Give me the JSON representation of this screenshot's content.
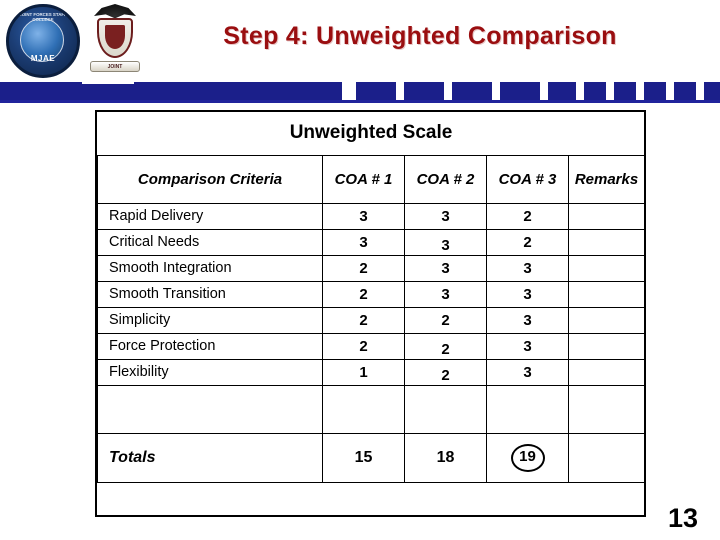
{
  "slide": {
    "title": "Step 4: Unweighted Comparison",
    "page_number": "13",
    "title_color": "#9a0e10",
    "banner_color": "#1b1f8a"
  },
  "logos": {
    "left_seal_name": "mjae-seal",
    "left_seal_arc_text": "JOINT FORCES STAFF COLLEGE",
    "left_seal_label": "MJAE",
    "right_crest_name": "jfsc-crest",
    "right_crest_motto": "JOINT"
  },
  "table": {
    "scale_header": "Unweighted Scale",
    "columns": [
      "Comparison Criteria",
      "COA # 1",
      "COA # 2",
      "COA # 3",
      "Remarks"
    ],
    "rows": [
      {
        "criteria": "Rapid Delivery",
        "coa1": "3",
        "coa2": "3",
        "coa3": "2",
        "remarks": ""
      },
      {
        "criteria": "Critical Needs",
        "coa1": "3",
        "coa2": "3",
        "coa3": "2",
        "remarks": ""
      },
      {
        "criteria": "Smooth Integration",
        "coa1": "2",
        "coa2": "3",
        "coa3": "3",
        "remarks": ""
      },
      {
        "criteria": "Smooth Transition",
        "coa1": "2",
        "coa2": "3",
        "coa3": "3",
        "remarks": ""
      },
      {
        "criteria": "Simplicity",
        "coa1": "2",
        "coa2": "2",
        "coa3": "3",
        "remarks": ""
      },
      {
        "criteria": "Force Protection",
        "coa1": "2",
        "coa2": "2",
        "coa3": "3",
        "remarks": ""
      },
      {
        "criteria": "Flexibility",
        "coa1": "1",
        "coa2": "2",
        "coa3": "3",
        "remarks": ""
      }
    ],
    "blank_row": {
      "criteria": "",
      "coa1": "",
      "coa2": "",
      "coa3": "",
      "remarks": ""
    },
    "totals": {
      "label": "Totals",
      "coa1": "15",
      "coa2": "18",
      "coa3": "19",
      "coa3_circled": true,
      "remarks": ""
    }
  }
}
